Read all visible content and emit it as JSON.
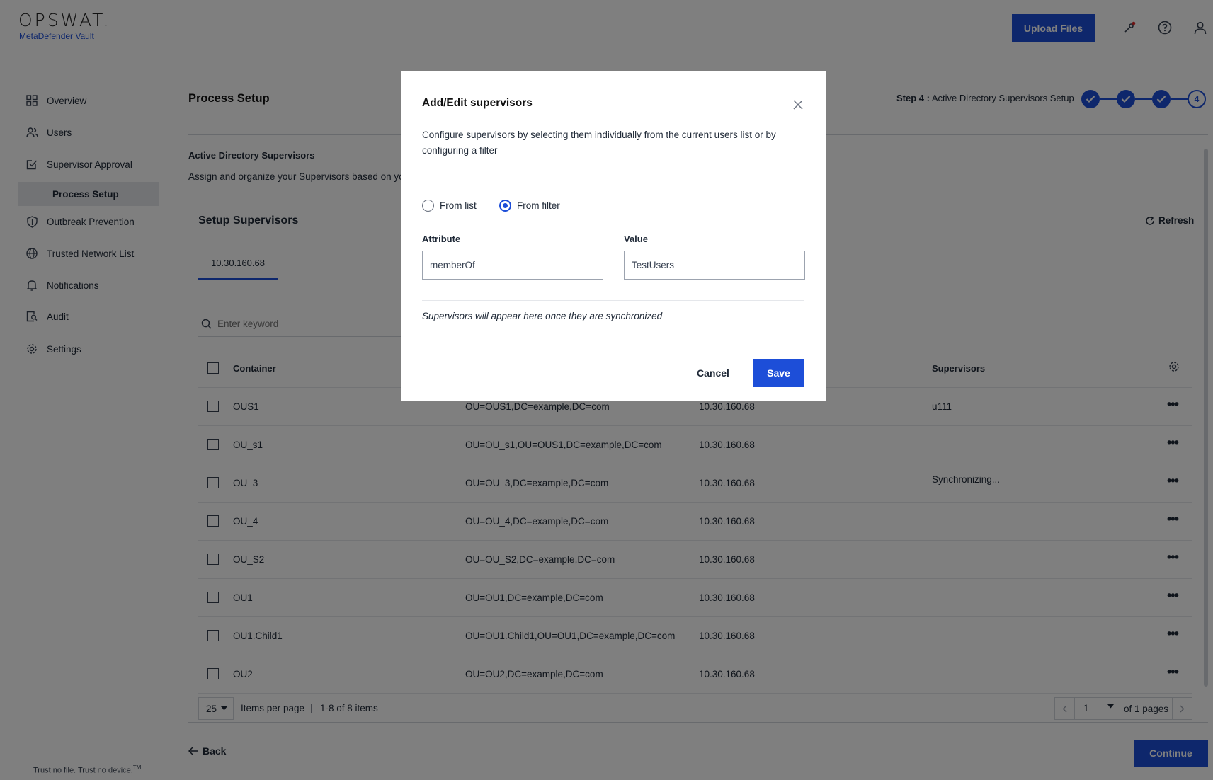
{
  "header": {
    "logo": "OPSWAT.",
    "product": "MetaDefender Vault",
    "upload_label": "Upload Files",
    "icons": [
      "key-alert-icon",
      "help-icon",
      "user-icon"
    ],
    "accent": "#1d4ed8"
  },
  "sidebar": {
    "items": [
      {
        "label": "Overview",
        "icon": "grid-icon"
      },
      {
        "label": "Users",
        "icon": "users-icon"
      },
      {
        "label": "Supervisor Approval",
        "icon": "approval-icon"
      },
      {
        "label": "Process Setup"
      },
      {
        "label": "Outbreak Prevention",
        "icon": "shield-icon"
      },
      {
        "label": "Trusted Network List",
        "icon": "globe-icon"
      },
      {
        "label": "Notifications",
        "icon": "bell-icon"
      },
      {
        "label": "Audit",
        "icon": "audit-icon"
      },
      {
        "label": "Settings",
        "icon": "gear-icon"
      }
    ],
    "tagline": "Trust no file. Trust no device.",
    "tagline_mark": "TM"
  },
  "main": {
    "title": "Process Setup",
    "step_prefix": "Step 4 :",
    "step_label": "Active Directory Supervisors Setup",
    "current_step": "4",
    "section_title": "Active Directory Supervisors",
    "section_desc": "Assign and organize your Supervisors based on you",
    "setup_title": "Setup Supervisors",
    "refresh_label": "Refresh",
    "tab_label": "10.30.160.68",
    "search_placeholder": "Enter keyword",
    "columns": {
      "container": "Container",
      "supervisors": "Supervisors"
    },
    "rows": [
      {
        "container": "OUS1",
        "dn": "OU=OUS1,DC=example,DC=com",
        "server": "10.30.160.68",
        "supervisors": "u111"
      },
      {
        "container": "OU_s1",
        "dn": "OU=OU_s1,OU=OUS1,DC=example,DC=com",
        "server": "10.30.160.68",
        "supervisors": ""
      },
      {
        "container": "OU_3",
        "dn": "OU=OU_3,DC=example,DC=com",
        "server": "10.30.160.68",
        "supervisors": "Synchronizing..."
      },
      {
        "container": "OU_4",
        "dn": "OU=OU_4,DC=example,DC=com",
        "server": "10.30.160.68",
        "supervisors": ""
      },
      {
        "container": "OU_S2",
        "dn": "OU=OU_S2,DC=example,DC=com",
        "server": "10.30.160.68",
        "supervisors": ""
      },
      {
        "container": "OU1",
        "dn": "OU=OU1,DC=example,DC=com",
        "server": "10.30.160.68",
        "supervisors": ""
      },
      {
        "container": "OU1.Child1",
        "dn": "OU=OU1.Child1,OU=OU1,DC=example,DC=com",
        "server": "10.30.160.68",
        "supervisors": ""
      },
      {
        "container": "OU2",
        "dn": "OU=OU2,DC=example,DC=com",
        "server": "10.30.160.68",
        "supervisors": ""
      }
    ],
    "pagination": {
      "per_page": "25",
      "per_page_label": "Items per page",
      "separator": "|",
      "count": "1-8 of 8 items",
      "page": "1",
      "of_pages": "of 1 pages"
    },
    "back_label": "Back",
    "continue_label": "Continue"
  },
  "modal": {
    "title": "Add/Edit supervisors",
    "description": "Configure supervisors by selecting them individually from the current users list or by configuring a filter",
    "option_list": "From list",
    "option_filter": "From filter",
    "selected_option": "From filter",
    "attribute_label": "Attribute",
    "attribute_value": "memberOf",
    "value_label": "Value",
    "value_value": "TestUsers",
    "note": "Supervisors will appear here once they are synchronized",
    "cancel_label": "Cancel",
    "save_label": "Save"
  }
}
